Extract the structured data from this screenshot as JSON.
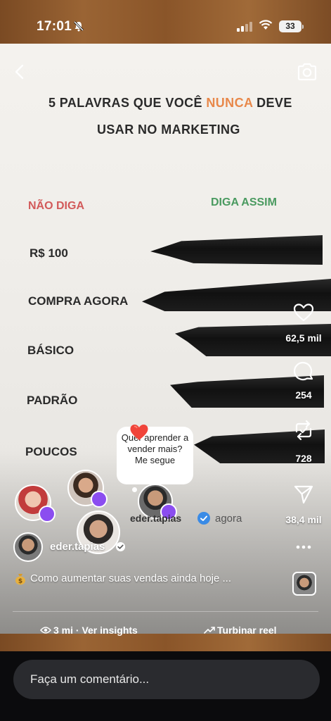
{
  "status_bar": {
    "time": "17:01",
    "battery": "33"
  },
  "video": {
    "title_part1": "5 PALAVRAS QUE VOCÊ ",
    "title_accent": "NUNCA",
    "title_part2": " DEVE",
    "title_line2": "USAR NO MARKETING",
    "col_dont": "NÃO DIGA",
    "col_do": "DIGA ASSIM",
    "words": [
      "R$ 100",
      "COMPRA AGORA",
      "BÁSICO",
      "PADRÃO",
      "POUCOS"
    ],
    "accent_color": "#e8884a",
    "dont_color": "#d25a5a",
    "do_color": "#4a9a60"
  },
  "actions": {
    "likes": "62,5 mil",
    "comments": "254",
    "reposts": "728",
    "shares": "38,4 mil"
  },
  "repost_note": {
    "text": "Quer aprender a vender mais? Me segue",
    "handle": "eder.tapias",
    "time": "agora"
  },
  "author": {
    "username": "eder.tapias"
  },
  "caption": "Como aumentar suas vendas ainda hoje ...",
  "footer": {
    "insights": "3 mi · Ver insights",
    "boost": "Turbinar reel"
  },
  "comment_placeholder": "Faça um comentário..."
}
